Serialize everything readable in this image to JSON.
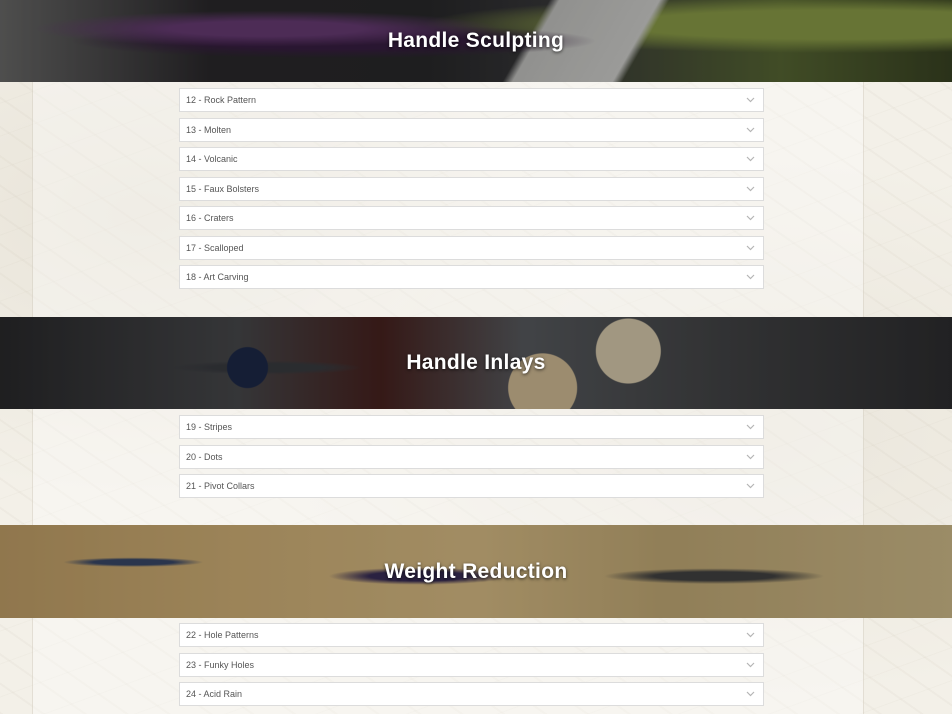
{
  "sections": [
    {
      "title": "Handle Sculpting",
      "items": [
        "12 - Rock Pattern",
        "13 - Molten",
        "14 - Volcanic",
        "15 - Faux Bolsters",
        "16 - Craters",
        "17 - Scalloped",
        "18 - Art Carving"
      ]
    },
    {
      "title": "Handle Inlays",
      "items": [
        "19 - Stripes",
        "20 - Dots",
        "21 - Pivot Collars"
      ]
    },
    {
      "title": "Weight Reduction",
      "items": [
        "22 - Hole Patterns",
        "23 - Funky Holes",
        "24 - Acid Rain"
      ]
    }
  ],
  "icons": {
    "accordion_toggle": "chevron-down-icon"
  },
  "colors": {
    "item_border": "#dcdcdc",
    "item_text": "#555555",
    "banner_title": "#ffffff"
  }
}
